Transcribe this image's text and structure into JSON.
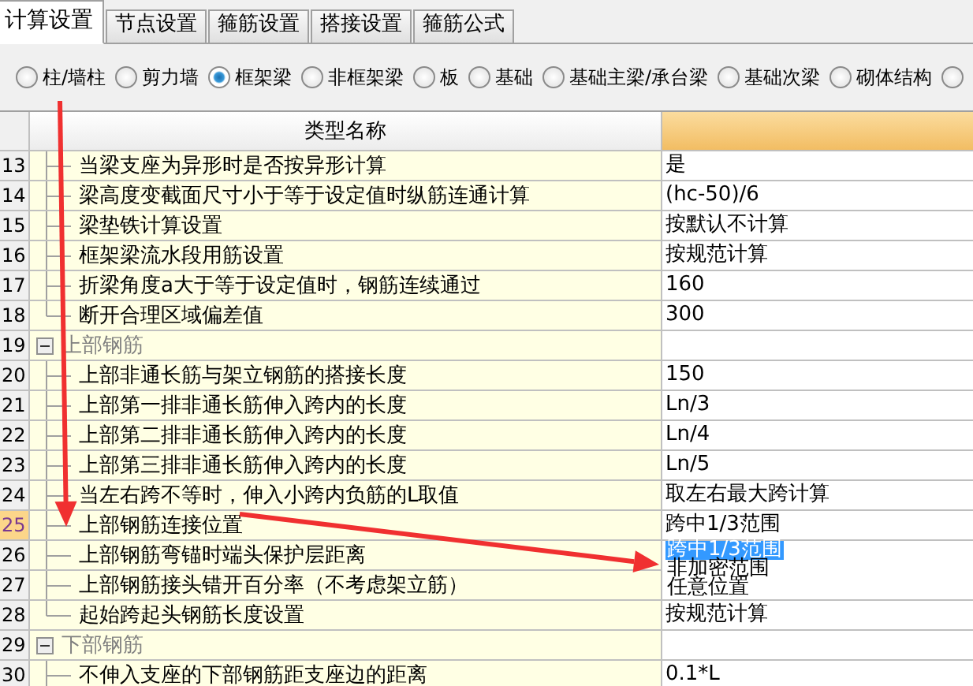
{
  "tabs": [
    {
      "label": "计算设置",
      "selected": true
    },
    {
      "label": "节点设置",
      "selected": false
    },
    {
      "label": "箍筋设置",
      "selected": false
    },
    {
      "label": "搭接设置",
      "selected": false
    },
    {
      "label": "箍筋公式",
      "selected": false
    }
  ],
  "radios": [
    {
      "label": "柱/墙柱",
      "selected": false
    },
    {
      "label": "剪力墙",
      "selected": false
    },
    {
      "label": "框架梁",
      "selected": true
    },
    {
      "label": "非框架梁",
      "selected": false
    },
    {
      "label": "板",
      "selected": false
    },
    {
      "label": "基础",
      "selected": false
    },
    {
      "label": "基础主梁/承台梁",
      "selected": false
    },
    {
      "label": "基础次梁",
      "selected": false
    },
    {
      "label": "砌体结构",
      "selected": false
    },
    {
      "selected": false
    }
  ],
  "table": {
    "name_header": "类型名称",
    "tree": [
      {
        "kind": "continued",
        "truncated": false,
        "children": [
          {
            "number": "13",
            "label": "当梁支座为异形时是否按异形计算",
            "value": "是",
            "selected": false
          },
          {
            "number": "14",
            "label": "梁高度变截面尺寸小于等于设定值时纵筋连通计算",
            "value": "(hc-50)/6",
            "selected": false
          },
          {
            "number": "15",
            "label": "梁垫铁计算设置",
            "value": "按默认不计算",
            "selected": false
          },
          {
            "number": "16",
            "label": "框架梁流水段用筋设置",
            "value": "按规范计算",
            "selected": false
          },
          {
            "number": "17",
            "label": "折梁角度a大于等于设定值时，钢筋连续通过",
            "value": "160",
            "selected": false
          },
          {
            "number": "18",
            "label": "断开合理区域偏差值",
            "value": "300",
            "selected": false
          }
        ]
      },
      {
        "kind": "group",
        "number": "19",
        "label": "上部钢筋",
        "expanded": true,
        "truncated": false,
        "children": [
          {
            "number": "20",
            "label": "上部非通长筋与架立钢筋的搭接长度",
            "value": "150",
            "selected": false
          },
          {
            "number": "21",
            "label": "上部第一排非通长筋伸入跨内的长度",
            "value": "Ln/3",
            "selected": false
          },
          {
            "number": "22",
            "label": "上部第二排非通长筋伸入跨内的长度",
            "value": "Ln/4",
            "selected": false
          },
          {
            "number": "23",
            "label": "上部第三排非通长筋伸入跨内的长度",
            "value": "Ln/5",
            "selected": false
          },
          {
            "number": "24",
            "label": "当左右跨不等时，伸入小跨内负筋的L取值",
            "value": "取左右最大跨计算",
            "selected": false
          },
          {
            "number": "25",
            "label": "上部钢筋连接位置",
            "value": "跨中1/3范围",
            "selected": true,
            "dropdown": [
              {
                "label": "跨中1/3范围",
                "selected": true
              },
              {
                "label": "非加密范围",
                "selected": false
              },
              {
                "label": "任意位置",
                "selected": false
              }
            ]
          },
          {
            "number": "26",
            "label": "上部钢筋弯锚时端头保护层距离",
            "selected": false
          },
          {
            "number": "27",
            "label": "上部钢筋接头错开百分率（不考虑架立筋）",
            "selected": false
          },
          {
            "number": "28",
            "label": "起始跨起头钢筋长度设置",
            "value": "按规范计算",
            "selected": false
          }
        ]
      },
      {
        "kind": "group",
        "number": "29",
        "label": "下部钢筋",
        "expanded": true,
        "truncated": true,
        "children": [
          {
            "number": "30",
            "label": "不伸入支座的下部钢筋距支座边的距离",
            "value": "0.1*L",
            "selected": false
          }
        ]
      }
    ]
  }
}
